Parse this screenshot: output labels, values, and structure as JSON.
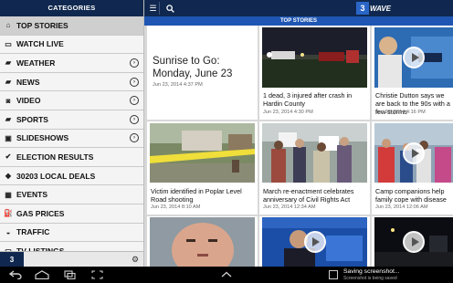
{
  "sidebar": {
    "header": "CATEGORIES",
    "items": [
      {
        "label": "TOP STORIES",
        "icon": "home-icon",
        "glyph": "⌂",
        "arrow": false
      },
      {
        "label": "WATCH LIVE",
        "icon": "tv-icon",
        "glyph": "▭",
        "arrow": false
      },
      {
        "label": "WEATHER",
        "icon": "folder-icon",
        "glyph": "▰",
        "arrow": true
      },
      {
        "label": "NEWS",
        "icon": "folder-icon",
        "glyph": "▰",
        "arrow": true
      },
      {
        "label": "VIDEO",
        "icon": "video-camera-icon",
        "glyph": "◙",
        "arrow": true
      },
      {
        "label": "SPORTS",
        "icon": "folder-icon",
        "glyph": "▰",
        "arrow": true
      },
      {
        "label": "SLIDESHOWS",
        "icon": "slideshow-icon",
        "glyph": "▣",
        "arrow": true
      },
      {
        "label": "ELECTION RESULTS",
        "icon": "checkmark-icon",
        "glyph": "✔",
        "arrow": false
      },
      {
        "label": "30203 LOCAL DEALS",
        "icon": "tag-icon",
        "glyph": "◆",
        "arrow": false
      },
      {
        "label": "EVENTS",
        "icon": "calendar-icon",
        "glyph": "▦",
        "arrow": false
      },
      {
        "label": "GAS PRICES",
        "icon": "gas-pump-icon",
        "glyph": "⛽",
        "arrow": false
      },
      {
        "label": "TRAFFIC",
        "icon": "car-icon",
        "glyph": "◒",
        "arrow": false
      },
      {
        "label": "TV LISTINGS",
        "icon": "tv-icon",
        "glyph": "▭",
        "arrow": false
      }
    ],
    "footer_logo": "3",
    "settings_icon": "gear-icon"
  },
  "topbar": {
    "menu_icon": "hamburger-menu-icon",
    "search_icon": "search-icon",
    "logo_number": "3",
    "logo_text": "WAVE",
    "section_label": "TOP STORIES"
  },
  "stories": [
    {
      "title": "Sunrise to Go: Monday, June 23",
      "date": "Jun 23, 2014 4:37 PM",
      "text_only": true,
      "video": false
    },
    {
      "title": "1 dead, 3 injured after crash in Hardin County",
      "date": "Jun 23, 2014 4:30 PM",
      "video": false
    },
    {
      "title": "Christie Dutton says we are back to the 90s with a few storms",
      "date": "Jun 23, 2014 4:16 PM",
      "video": true
    },
    {
      "title": "Victim identified in Poplar Level Road shooting",
      "date": "Jun 23, 2014 8:10 AM",
      "video": false
    },
    {
      "title": "March re-enactment celebrates anniversary of Civil Rights Act",
      "date": "Jun 23, 2014 12:34 AM",
      "video": false
    },
    {
      "title": "Camp companions help family cope with disease",
      "date": "Jun 23, 2014 12:06 AM",
      "video": true
    },
    {
      "title": "",
      "date": "",
      "video": false
    },
    {
      "title": "",
      "date": "",
      "video": true
    },
    {
      "title": "",
      "date": "",
      "video": true
    }
  ],
  "navbar": {
    "back_icon": "back-arrow-icon",
    "home_icon": "home-icon",
    "recent_apps_icon": "recent-apps-icon",
    "screenshot_icon": "screenshot-icon",
    "up_chevron_icon": "chevron-up-icon",
    "notification_title": "Saving screenshot...",
    "notification_sub": "Screenshot is being saved"
  },
  "colors": {
    "header": "#10284f",
    "accent": "#1f56b3"
  }
}
